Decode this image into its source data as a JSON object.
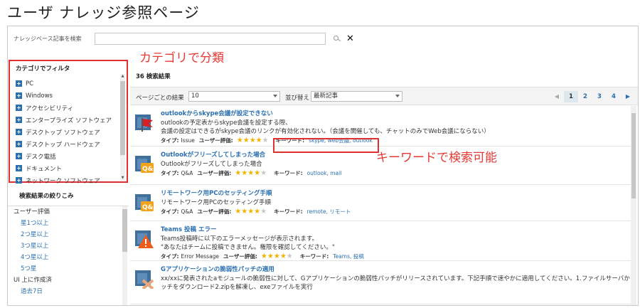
{
  "page": {
    "title": "ユーザ ナレッジ参照ページ"
  },
  "search": {
    "label": "ナレッジベース記事を検索",
    "value": "",
    "placeholder": ""
  },
  "filter": {
    "title": "カテゴリでフィルタ",
    "items": [
      {
        "label": "PC"
      },
      {
        "label": "Windows"
      },
      {
        "label": "アクセシビリティ"
      },
      {
        "label": "エンタープライズ ソフトウェア"
      },
      {
        "label": "デスクトップ ソフトウェア"
      },
      {
        "label": "デスクトップ ハードウェア"
      },
      {
        "label": "デスク電話"
      },
      {
        "label": "ドキュメント"
      },
      {
        "label": "ネットワーク ソフトウェア"
      }
    ]
  },
  "narrow": {
    "title": "検索結果の絞りこみ",
    "rating_heading": "ユーザー評価",
    "ratings": [
      {
        "label": "星1つ以上"
      },
      {
        "label": "2つ星以上"
      },
      {
        "label": "3つ星以上"
      },
      {
        "label": "4つ星以上"
      },
      {
        "label": "5つ星"
      }
    ],
    "date_heading": "UI 上に作成済",
    "dates": [
      {
        "label": "過去7日"
      }
    ]
  },
  "annotations": {
    "category": "カテゴリで分類",
    "keyword": "キーワードで検索可能",
    "color": "#e53935"
  },
  "results_count": "36 検索結果",
  "controls": {
    "per_page_label": "ページごとの結果",
    "per_page_value": "10",
    "sort_label": "並び替え",
    "sort_value": "最新記事",
    "pages": [
      "1",
      "2",
      "3",
      "4"
    ],
    "current_page": "1"
  },
  "labels": {
    "type": "タイプ:",
    "rating": "ユーザー評価:",
    "keywords": "キーワード:"
  },
  "results": [
    {
      "icon": "flag-icon",
      "title": "outlookからskype会議が設定できない",
      "lines": [
        "outlookの予定表からskype会議を設定する際、",
        "会議の設定はできるがskype会議のリンクが有効化されない。（会議を開催しても、チャットのみでWeb会議にならない）"
      ],
      "type": "Issue",
      "rating": 4,
      "keywords": "skype, web会議, outlook"
    },
    {
      "icon": "qa-icon",
      "title": "Outlookがフリーズしてしまった場合",
      "lines": [
        "Outlookがフリーズしてしまった場合"
      ],
      "type": "Q&A",
      "rating": 4,
      "keywords": "outlook, mail"
    },
    {
      "icon": "qa-icon",
      "title": "リモートワーク用PCのセッティング手順",
      "lines": [
        "リモートワーク用PCのセッティング手順"
      ],
      "type": "Q&A",
      "rating": 4,
      "keywords": "remote, リモート"
    },
    {
      "icon": "warning-icon",
      "title": "Teams 投稿 エラー",
      "lines": [
        "Teams投稿時に以下のエラーメッセージが表示されます。",
        "\"あなたはチームに投稿できません。権限を確認してください。\""
      ],
      "type": "Error Message",
      "rating": 4,
      "keywords": "Teams, 投稿"
    },
    {
      "icon": "patch-icon",
      "title": "Gアプリケーションの脆弱性パッチの適用",
      "lines": [
        "xx/xxに発表されたaモジュールの脆弱性に対して、Gアプリケーションの脆弱性パッチがリリースされています。下記手順で速やかに適用してください。1.ファイルサーバからパ",
        "ッチをダウンロード2.zipを解凍し、exeファイルを実行"
      ],
      "type": "",
      "rating": 0,
      "keywords": ""
    }
  ]
}
